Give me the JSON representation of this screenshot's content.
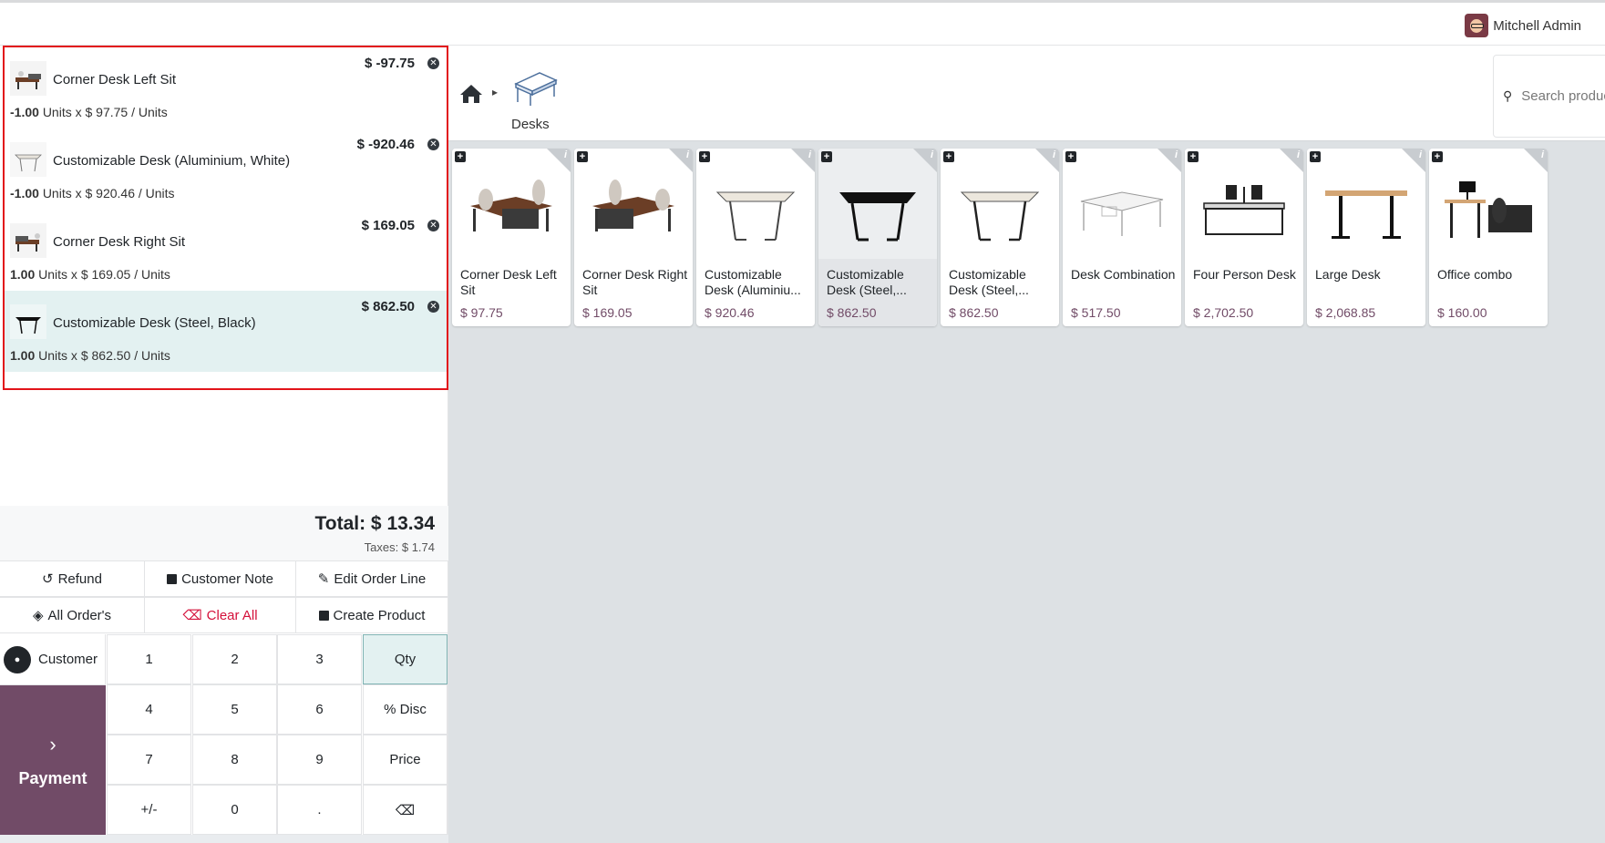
{
  "user": {
    "name": "Mitchell Admin"
  },
  "order": {
    "lines": [
      {
        "name": "Corner Desk Left Sit",
        "price": "$ -97.75",
        "qty": "-1.00",
        "detail": "Units x $ 97.75 / Units"
      },
      {
        "name": "Customizable Desk (Aluminium, White)",
        "price": "$ -920.46",
        "qty": "-1.00",
        "detail": "Units x $ 920.46 / Units"
      },
      {
        "name": "Corner Desk Right Sit",
        "price": "$ 169.05",
        "qty": "1.00",
        "detail": "Units x $ 169.05 / Units"
      },
      {
        "name": "Customizable Desk (Steel, Black)",
        "price": "$ 862.50",
        "qty": "1.00",
        "detail": "Units x $ 862.50 / Units"
      }
    ],
    "total": "Total: $ 13.34",
    "taxes": "Taxes: $ 1.74"
  },
  "controls": {
    "refund": "Refund",
    "customer_note": "Customer Note",
    "edit_order_line": "Edit Order Line",
    "all_orders": "All Order's",
    "clear_all": "Clear All",
    "create_product": "Create Product"
  },
  "customer": "Customer",
  "payment": "Payment",
  "keypad": {
    "k1": "1",
    "k2": "2",
    "k3": "3",
    "qty": "Qty",
    "k4": "4",
    "k5": "5",
    "k6": "6",
    "disc": "% Disc",
    "k7": "7",
    "k8": "8",
    "k9": "9",
    "price": "Price",
    "pm": "+/-",
    "k0": "0",
    "dot": ".",
    "back": "⌫"
  },
  "breadcrumb": {
    "category": "Desks"
  },
  "search": {
    "placeholder": "Search products..."
  },
  "products": [
    {
      "name": "Corner Desk Left Sit",
      "price": "$ 97.75",
      "icon": "corner-desk"
    },
    {
      "name": "Corner Desk Right Sit",
      "price": "$ 169.05",
      "icon": "corner-desk"
    },
    {
      "name": "Customizable Desk (Aluminiu...",
      "price": "$ 920.46",
      "icon": "desk-white"
    },
    {
      "name": "Customizable Desk (Steel,...",
      "price": "$ 862.50",
      "icon": "desk-black"
    },
    {
      "name": "Customizable Desk (Steel,...",
      "price": "$ 862.50",
      "icon": "desk-white"
    },
    {
      "name": "Desk Combination",
      "price": "$ 517.50",
      "icon": "desk-combination"
    },
    {
      "name": "Four Person Desk",
      "price": "$ 2,702.50",
      "icon": "four-person-desk"
    },
    {
      "name": "Large Desk",
      "price": "$ 2,068.85",
      "icon": "large-desk"
    },
    {
      "name": "Office combo",
      "price": "$ 160.00",
      "icon": "office-combo"
    }
  ],
  "colors": {
    "brand": "#714b67",
    "selected_line": "#e3f1f1",
    "highlight_border": "#e2141a",
    "clear_all": "#d4103a"
  }
}
